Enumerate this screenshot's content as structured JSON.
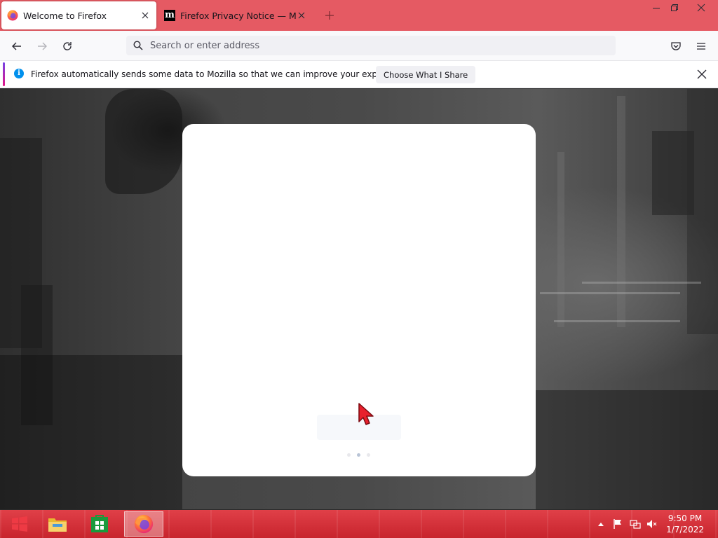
{
  "tabs": [
    {
      "title": "Welcome to Firefox",
      "active": true,
      "favicon": "firefox-icon"
    },
    {
      "title": "Firefox Privacy Notice — Mozilla",
      "active": false,
      "favicon": "mozilla-m-icon",
      "favicon_text": "m"
    }
  ],
  "window_controls": [
    "minimize-icon",
    "restore-icon",
    "close-icon"
  ],
  "navbar": {
    "url_placeholder": "Search or enter address",
    "url_value": ""
  },
  "notification": {
    "message": "Firefox automatically sends some data to Mozilla so that we can improve your experience.",
    "button_label": "Choose What I Share"
  },
  "onboarding": {
    "dots_total": 3,
    "dots_active": 2
  },
  "taskbar": {
    "items": [
      "windows-start-icon",
      "file-explorer-icon",
      "store-icon",
      "firefox-icon"
    ],
    "tray_icons": [
      "show-hidden-icons-icon",
      "action-center-flag-icon",
      "network-icon",
      "volume-muted-icon"
    ],
    "time": "9:50 PM",
    "date": "1/7/2022"
  },
  "colors": {
    "titlebar": "#e55a63",
    "taskbar": "#d2303a",
    "info_blue": "#0090ed"
  }
}
